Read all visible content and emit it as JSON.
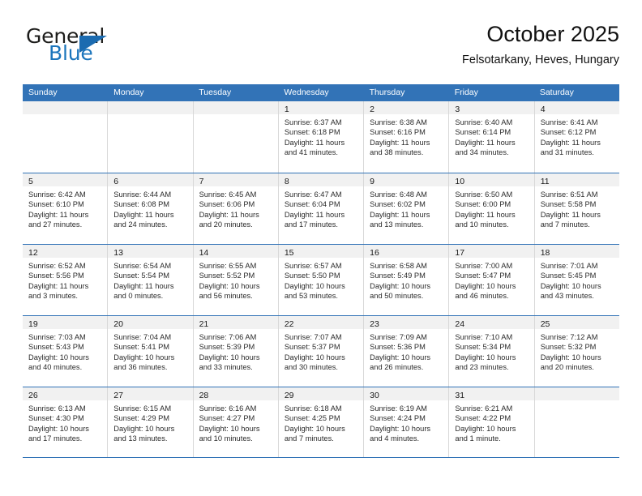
{
  "brand": {
    "name_part1": "General",
    "name_part2": "Blue",
    "logo_icon": "triangle-logo-icon",
    "accent_color": "#1b75bc"
  },
  "header": {
    "title": "October 2025",
    "subtitle": "Felsotarkany, Heves, Hungary"
  },
  "theme": {
    "header_band": "#3273b7",
    "daynum_strip": "#f1f1f1",
    "grid_line": "#d8d8d8"
  },
  "weekday_headers": [
    "Sunday",
    "Monday",
    "Tuesday",
    "Wednesday",
    "Thursday",
    "Friday",
    "Saturday"
  ],
  "labels": {
    "sunrise_prefix": "Sunrise:",
    "sunset_prefix": "Sunset:",
    "daylight_prefix": "Daylight:"
  },
  "weeks": [
    [
      {
        "day": "",
        "line1": "",
        "line2": "",
        "line3": "",
        "line4": ""
      },
      {
        "day": "",
        "line1": "",
        "line2": "",
        "line3": "",
        "line4": ""
      },
      {
        "day": "",
        "line1": "",
        "line2": "",
        "line3": "",
        "line4": ""
      },
      {
        "day": "1",
        "line1": "Sunrise: 6:37 AM",
        "line2": "Sunset: 6:18 PM",
        "line3": "Daylight: 11 hours",
        "line4": "and 41 minutes."
      },
      {
        "day": "2",
        "line1": "Sunrise: 6:38 AM",
        "line2": "Sunset: 6:16 PM",
        "line3": "Daylight: 11 hours",
        "line4": "and 38 minutes."
      },
      {
        "day": "3",
        "line1": "Sunrise: 6:40 AM",
        "line2": "Sunset: 6:14 PM",
        "line3": "Daylight: 11 hours",
        "line4": "and 34 minutes."
      },
      {
        "day": "4",
        "line1": "Sunrise: 6:41 AM",
        "line2": "Sunset: 6:12 PM",
        "line3": "Daylight: 11 hours",
        "line4": "and 31 minutes."
      }
    ],
    [
      {
        "day": "5",
        "line1": "Sunrise: 6:42 AM",
        "line2": "Sunset: 6:10 PM",
        "line3": "Daylight: 11 hours",
        "line4": "and 27 minutes."
      },
      {
        "day": "6",
        "line1": "Sunrise: 6:44 AM",
        "line2": "Sunset: 6:08 PM",
        "line3": "Daylight: 11 hours",
        "line4": "and 24 minutes."
      },
      {
        "day": "7",
        "line1": "Sunrise: 6:45 AM",
        "line2": "Sunset: 6:06 PM",
        "line3": "Daylight: 11 hours",
        "line4": "and 20 minutes."
      },
      {
        "day": "8",
        "line1": "Sunrise: 6:47 AM",
        "line2": "Sunset: 6:04 PM",
        "line3": "Daylight: 11 hours",
        "line4": "and 17 minutes."
      },
      {
        "day": "9",
        "line1": "Sunrise: 6:48 AM",
        "line2": "Sunset: 6:02 PM",
        "line3": "Daylight: 11 hours",
        "line4": "and 13 minutes."
      },
      {
        "day": "10",
        "line1": "Sunrise: 6:50 AM",
        "line2": "Sunset: 6:00 PM",
        "line3": "Daylight: 11 hours",
        "line4": "and 10 minutes."
      },
      {
        "day": "11",
        "line1": "Sunrise: 6:51 AM",
        "line2": "Sunset: 5:58 PM",
        "line3": "Daylight: 11 hours",
        "line4": "and 7 minutes."
      }
    ],
    [
      {
        "day": "12",
        "line1": "Sunrise: 6:52 AM",
        "line2": "Sunset: 5:56 PM",
        "line3": "Daylight: 11 hours",
        "line4": "and 3 minutes."
      },
      {
        "day": "13",
        "line1": "Sunrise: 6:54 AM",
        "line2": "Sunset: 5:54 PM",
        "line3": "Daylight: 11 hours",
        "line4": "and 0 minutes."
      },
      {
        "day": "14",
        "line1": "Sunrise: 6:55 AM",
        "line2": "Sunset: 5:52 PM",
        "line3": "Daylight: 10 hours",
        "line4": "and 56 minutes."
      },
      {
        "day": "15",
        "line1": "Sunrise: 6:57 AM",
        "line2": "Sunset: 5:50 PM",
        "line3": "Daylight: 10 hours",
        "line4": "and 53 minutes."
      },
      {
        "day": "16",
        "line1": "Sunrise: 6:58 AM",
        "line2": "Sunset: 5:49 PM",
        "line3": "Daylight: 10 hours",
        "line4": "and 50 minutes."
      },
      {
        "day": "17",
        "line1": "Sunrise: 7:00 AM",
        "line2": "Sunset: 5:47 PM",
        "line3": "Daylight: 10 hours",
        "line4": "and 46 minutes."
      },
      {
        "day": "18",
        "line1": "Sunrise: 7:01 AM",
        "line2": "Sunset: 5:45 PM",
        "line3": "Daylight: 10 hours",
        "line4": "and 43 minutes."
      }
    ],
    [
      {
        "day": "19",
        "line1": "Sunrise: 7:03 AM",
        "line2": "Sunset: 5:43 PM",
        "line3": "Daylight: 10 hours",
        "line4": "and 40 minutes."
      },
      {
        "day": "20",
        "line1": "Sunrise: 7:04 AM",
        "line2": "Sunset: 5:41 PM",
        "line3": "Daylight: 10 hours",
        "line4": "and 36 minutes."
      },
      {
        "day": "21",
        "line1": "Sunrise: 7:06 AM",
        "line2": "Sunset: 5:39 PM",
        "line3": "Daylight: 10 hours",
        "line4": "and 33 minutes."
      },
      {
        "day": "22",
        "line1": "Sunrise: 7:07 AM",
        "line2": "Sunset: 5:37 PM",
        "line3": "Daylight: 10 hours",
        "line4": "and 30 minutes."
      },
      {
        "day": "23",
        "line1": "Sunrise: 7:09 AM",
        "line2": "Sunset: 5:36 PM",
        "line3": "Daylight: 10 hours",
        "line4": "and 26 minutes."
      },
      {
        "day": "24",
        "line1": "Sunrise: 7:10 AM",
        "line2": "Sunset: 5:34 PM",
        "line3": "Daylight: 10 hours",
        "line4": "and 23 minutes."
      },
      {
        "day": "25",
        "line1": "Sunrise: 7:12 AM",
        "line2": "Sunset: 5:32 PM",
        "line3": "Daylight: 10 hours",
        "line4": "and 20 minutes."
      }
    ],
    [
      {
        "day": "26",
        "line1": "Sunrise: 6:13 AM",
        "line2": "Sunset: 4:30 PM",
        "line3": "Daylight: 10 hours",
        "line4": "and 17 minutes."
      },
      {
        "day": "27",
        "line1": "Sunrise: 6:15 AM",
        "line2": "Sunset: 4:29 PM",
        "line3": "Daylight: 10 hours",
        "line4": "and 13 minutes."
      },
      {
        "day": "28",
        "line1": "Sunrise: 6:16 AM",
        "line2": "Sunset: 4:27 PM",
        "line3": "Daylight: 10 hours",
        "line4": "and 10 minutes."
      },
      {
        "day": "29",
        "line1": "Sunrise: 6:18 AM",
        "line2": "Sunset: 4:25 PM",
        "line3": "Daylight: 10 hours",
        "line4": "and 7 minutes."
      },
      {
        "day": "30",
        "line1": "Sunrise: 6:19 AM",
        "line2": "Sunset: 4:24 PM",
        "line3": "Daylight: 10 hours",
        "line4": "and 4 minutes."
      },
      {
        "day": "31",
        "line1": "Sunrise: 6:21 AM",
        "line2": "Sunset: 4:22 PM",
        "line3": "Daylight: 10 hours",
        "line4": "and 1 minute."
      },
      {
        "day": "",
        "line1": "",
        "line2": "",
        "line3": "",
        "line4": ""
      }
    ]
  ]
}
